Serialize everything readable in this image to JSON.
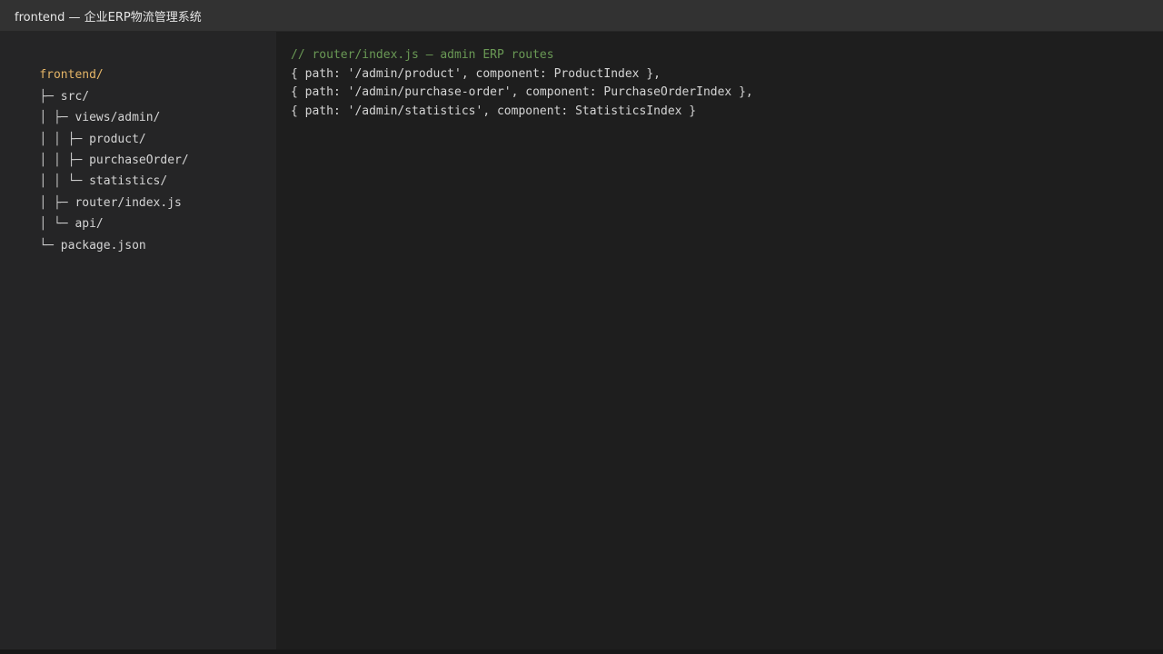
{
  "window": {
    "title": "frontend — 企业ERP物流管理系统"
  },
  "sidebar": {
    "tree": [
      {
        "prefix": "",
        "label": "frontend/"
      },
      {
        "prefix": "├─ ",
        "label": "src/"
      },
      {
        "prefix": "│ ├─ ",
        "label": "views/admin/"
      },
      {
        "prefix": "│ │ ├─ ",
        "label": "product/"
      },
      {
        "prefix": "│ │ ├─ ",
        "label": "purchaseOrder/"
      },
      {
        "prefix": "│ │ └─ ",
        "label": "statistics/"
      },
      {
        "prefix": "│ ├─ ",
        "label": "router/index.js"
      },
      {
        "prefix": "│ └─ ",
        "label": "api/"
      },
      {
        "prefix": "└─ ",
        "label": "package.json"
      }
    ]
  },
  "editor": {
    "lines": [
      "// router/index.js — admin ERP routes",
      "{ path: '/admin/product', component: ProductIndex },",
      "{ path: '/admin/purchase-order', component: PurchaseOrderIndex },",
      "{ path: '/admin/statistics', component: StatisticsIndex }"
    ]
  },
  "colors": {
    "background": "#1e1e1e",
    "sidebar": "#252526",
    "titlebar": "#323232",
    "root_folder": "#e5b567",
    "comment": "#6a9955",
    "text": "#d4d4d4"
  }
}
